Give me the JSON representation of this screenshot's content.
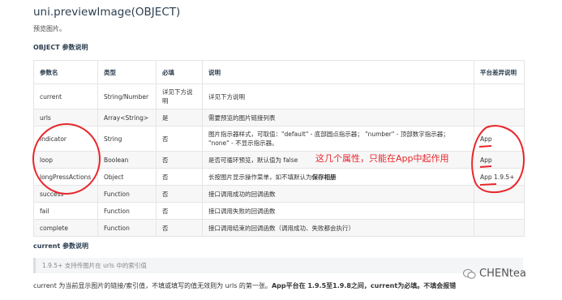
{
  "page": {
    "title": "uni.previewImage(OBJECT)",
    "description": "预览图片。",
    "object_section": "OBJECT 参数说明",
    "current_section": "current 参数说明",
    "note": "1.9.5+ 支持传图片在 urls 中的索引值",
    "footer_normal1": "current 为当前显示图片的链接/索引值，不填或填写的值无效则为 urls 的第一张。",
    "footer_bold": "App平台在 1.9.5至1.9.8之间，current为必填。不填会报错",
    "annotation": "这几个属性，只能在App中起作用",
    "watermark": "CHENtea"
  },
  "table": {
    "headers": [
      "参数名",
      "类型",
      "必填",
      "说明",
      "平台差异说明"
    ],
    "rows": [
      {
        "name": "current",
        "type": "String/Number",
        "required": "详见下方说明",
        "desc": "详见下方说明",
        "platform": ""
      },
      {
        "name": "urls",
        "type": "Array<String>",
        "required": "是",
        "desc": "需要预览的图片链接列表",
        "platform": ""
      },
      {
        "name": "indicator",
        "type": "String",
        "required": "否",
        "desc": "图片指示器样式，可取值：\"default\" - 底部圆点指示器； \"number\" - 顶部数字指示器； \"none\" - 不显示指示器。",
        "platform": "App"
      },
      {
        "name": "loop",
        "type": "Boolean",
        "required": "否",
        "desc": "是否可循环预览，默认值为 false",
        "platform": "App"
      },
      {
        "name": "longPressActions",
        "type": "Object",
        "required": "否",
        "desc_pre": "长按图片显示操作菜单，如不填默认为",
        "desc_bold": "保存相册",
        "platform": "App 1.9.5+"
      },
      {
        "name": "success",
        "type": "Function",
        "required": "否",
        "desc": "接口调用成功的回调函数",
        "platform": ""
      },
      {
        "name": "fail",
        "type": "Function",
        "required": "否",
        "desc": "接口调用失败的回调函数",
        "platform": ""
      },
      {
        "name": "complete",
        "type": "Function",
        "required": "否",
        "desc": "接口调用结束的回调函数（调用成功、失败都会执行）",
        "platform": ""
      }
    ]
  },
  "colors": {
    "annotation_red": "#e8262b"
  }
}
